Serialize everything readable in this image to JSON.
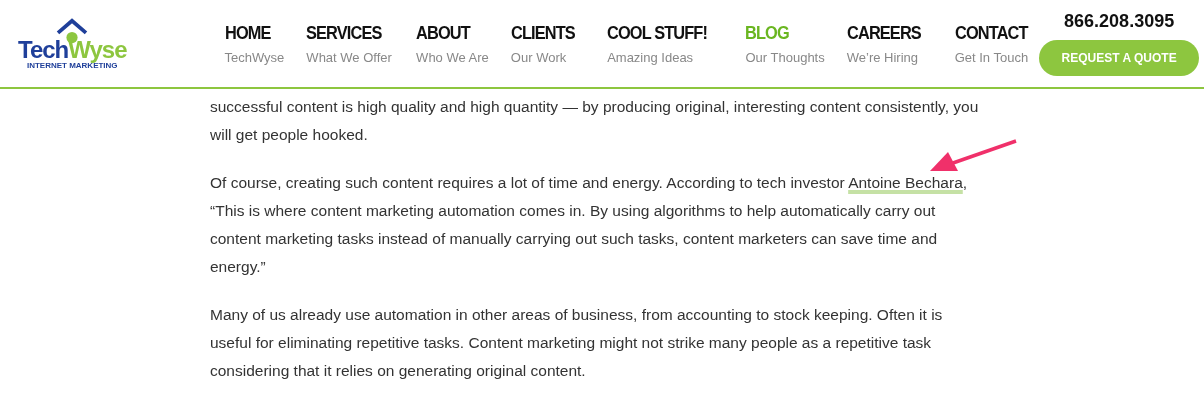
{
  "logo": {
    "part_1": "Tech",
    "part_2": "Wyse",
    "tagline": "INTERNET MARKETING"
  },
  "nav": [
    {
      "label": "HOME",
      "sub": "TechWyse",
      "selected": false
    },
    {
      "label": "SERVICES",
      "sub": "What We Offer",
      "selected": false
    },
    {
      "label": "ABOUT",
      "sub": "Who We Are",
      "selected": false
    },
    {
      "label": "CLIENTS",
      "sub": "Our Work",
      "selected": false
    },
    {
      "label": "COOL STUFF!",
      "sub": "Amazing Ideas",
      "selected": false
    },
    {
      "label": "BLOG",
      "sub": "Our Thoughts",
      "selected": true
    },
    {
      "label": "CAREERS",
      "sub": "We’re Hiring",
      "selected": false
    },
    {
      "label": "CONTACT",
      "sub": "Get In Touch",
      "selected": false
    }
  ],
  "phone": "866.208.3095",
  "quote_button": "REQUEST A QUOTE",
  "article": [
    {
      "text": "successful content is high quality and high quantity — by producing original, interesting content consistently, you will get people hooked."
    },
    {
      "before": "Of course, creating such content requires a lot of time and energy. According to tech investor",
      "link": "Antoine Bechara",
      "after": ", “This is where content marketing automation comes in. By using algorithms to help automatically carry out content marketing tasks instead of manually carrying out such tasks, content marketers can save time and energy.”"
    },
    {
      "text": "Many of us already use automation in other areas of business, from accounting to stock keeping. Often it is useful for eliminating repetitive tasks. Content marketing might not strike many people as a repetitive task considering that it relies on generating original content."
    }
  ]
}
